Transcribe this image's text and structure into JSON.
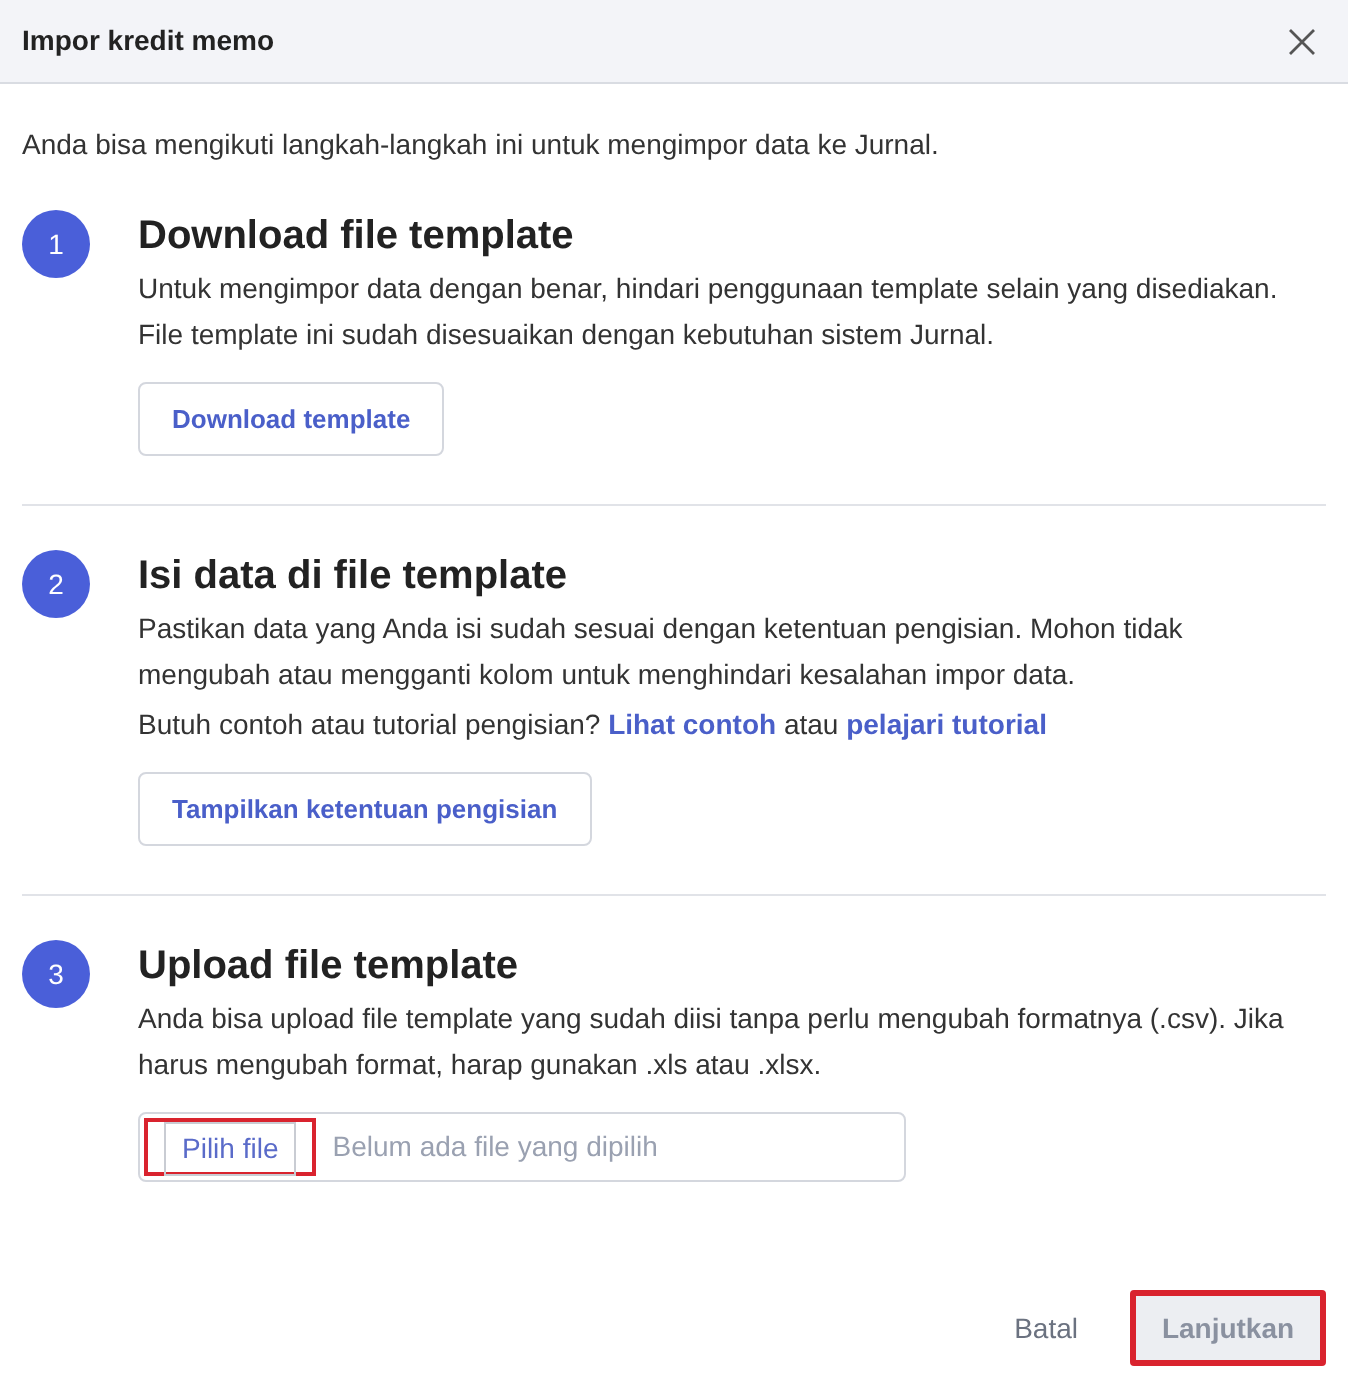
{
  "dialog": {
    "title": "Impor kredit memo",
    "intro": "Anda bisa mengikuti langkah-langkah ini untuk mengimpor data ke Jurnal.",
    "steps": [
      {
        "number": "1",
        "title": "Download file template",
        "paragraphs": [
          [
            {
              "kind": "text",
              "text": "Untuk mengimpor data dengan benar, hindari penggunaan template selain yang disediakan. File template ini sudah disesuaikan dengan kebutuhan sistem Jurnal."
            }
          ]
        ],
        "action": {
          "kind": "button",
          "label": "Download template"
        }
      },
      {
        "number": "2",
        "title": "Isi data di file template",
        "paragraphs": [
          [
            {
              "kind": "text",
              "text": "Pastikan data yang Anda isi sudah sesuai dengan ketentuan pengisian. Mohon tidak mengubah atau mengganti kolom untuk menghindari kesalahan impor data."
            }
          ],
          [
            {
              "kind": "text",
              "text": "Butuh contoh atau tutorial pengisian? "
            },
            {
              "kind": "link",
              "text": "Lihat contoh"
            },
            {
              "kind": "text",
              "text": " atau "
            },
            {
              "kind": "link",
              "text": "pelajari tutorial"
            }
          ]
        ],
        "action": {
          "kind": "button",
          "label": "Tampilkan ketentuan pengisian"
        }
      },
      {
        "number": "3",
        "title": "Upload file template",
        "paragraphs": [
          [
            {
              "kind": "text",
              "text": "Anda bisa upload file template yang sudah diisi tanpa perlu mengubah formatnya (.csv). Jika harus mengubah format, harap gunakan .xls atau .xlsx."
            }
          ]
        ],
        "action": {
          "kind": "file",
          "label": "Pilih file",
          "placeholder": "Belum ada file yang dipilih",
          "highlighted": true
        }
      }
    ],
    "footer": {
      "cancel": "Batal",
      "next": {
        "label": "Lanjutkan",
        "disabled": true,
        "highlighted": true
      }
    }
  }
}
